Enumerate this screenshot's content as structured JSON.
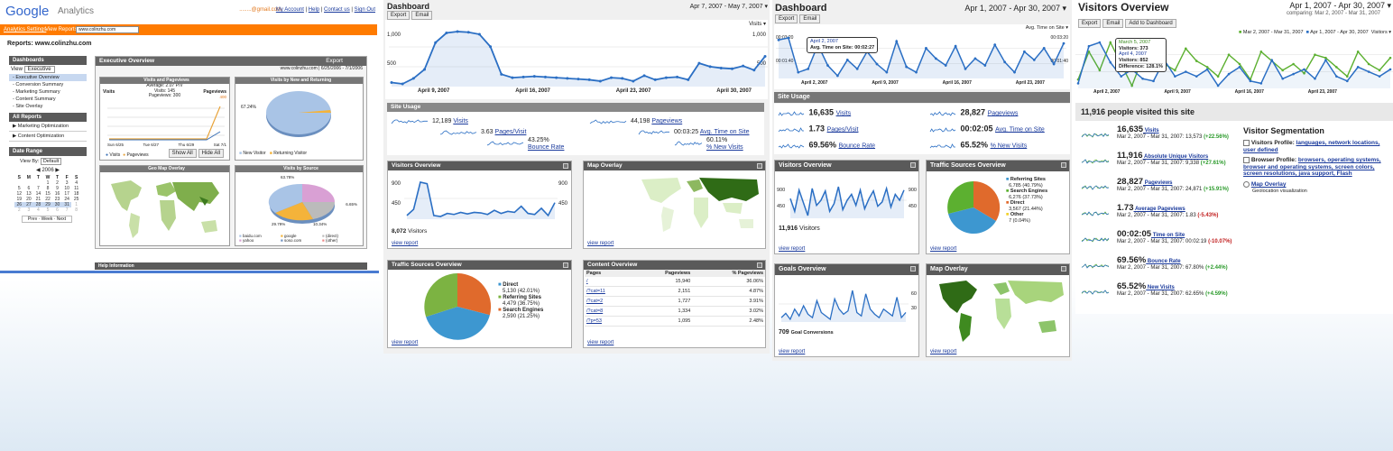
{
  "ga1": {
    "logo_google": "Google",
    "logo_analytics": "Analytics",
    "email": "........@gmail.com",
    "top_links": [
      "My Account",
      "Help",
      "Contact us",
      "Sign Out"
    ],
    "nav": [
      "Analytics Settings",
      "View Reports:"
    ],
    "site_select": "www.colinzhu.com",
    "reports_title": "Reports: www.colinzhu.com",
    "dash_hdr": "Dashboards",
    "view_label": "View",
    "view_select": "Executive",
    "menu": [
      "- Executive Overview",
      "- Conversion Summary",
      "- Marketing Summary",
      "- Content Summary",
      "- Site Overlay"
    ],
    "all_reports": "All Reports",
    "all_items": [
      "Marketing Optimization",
      "Content Optimization"
    ],
    "date_range": "Date Range",
    "viewby": "View By:",
    "viewby_val": "Default",
    "cal_month": "2006",
    "cal_days": [
      "S",
      "M",
      "T",
      "W",
      "T",
      "F",
      "S"
    ],
    "cal_nav": "Prev · Week · Next",
    "exec_title": "Executive Overview",
    "export": "Export",
    "site_date": "www.colinzhu.com",
    "date_span": "6/25/2006 - 7/1/2006",
    "vp_title": "Visits and Pageviews",
    "vp_avg": "Average: 2.07 P/V",
    "vp_visits": "Visits: 145",
    "vp_pv": "Pageviews: 300",
    "vp_l": "Visits",
    "vp_r": "Pageviews",
    "vp_rval": "400",
    "vp_days": [
      "Sun 6/25",
      "Tue 6/27",
      "Thu 6/29",
      "Sat 7/1"
    ],
    "legend_v": "Visits",
    "legend_p": "Pageviews",
    "show_all": "Show All",
    "hide_all": "Hide All",
    "nr_title": "Visits by New and Returning",
    "nr_pct": "67.24%",
    "nr_leg": [
      "New Visitor",
      "Returning Visitor"
    ],
    "geo_title": "Geo Map Overlay",
    "src_title": "Visits by Source",
    "src_pcts": [
      "63.78%",
      "6.65%",
      "29.79%",
      "10.34%"
    ],
    "src_leg": [
      "baidu.com",
      "google",
      "(direct)",
      "yahoo",
      "soso.com",
      "(other)"
    ],
    "help": "Help Information"
  },
  "ga2": {
    "title": "Dashboard",
    "date": "Apr 7, 2007 - May 7, 2007",
    "export": "Export",
    "email": "Email",
    "metric": "Visits",
    "y_top": "1,000",
    "y_mid": "500",
    "y_top_r": "1,000",
    "y_mid_r": "500",
    "x_labels": [
      "April 9, 2007",
      "April 16, 2007",
      "April 23, 2007",
      "April 30, 2007"
    ],
    "site_usage": "Site Usage",
    "usage": [
      {
        "v": "12,189",
        "l": "Visits"
      },
      {
        "v": "3.63",
        "l": "Pages/Visit"
      },
      {
        "v": "43.25%",
        "l": "Bounce Rate"
      },
      {
        "v": "44,198",
        "l": "Pageviews"
      },
      {
        "v": "00:03:25",
        "l": "Avg. Time on Site"
      },
      {
        "v": "60.11%",
        "l": "% New Visits"
      }
    ],
    "vo_title": "Visitors Overview",
    "vo_y": [
      "900",
      "450"
    ],
    "vo_visitors": "8,072",
    "vo_vl": "Visitors",
    "map_title": "Map Overlay",
    "ts_title": "Traffic Sources Overview",
    "ts": [
      {
        "n": "Direct",
        "v": "5,130 (42.01%)"
      },
      {
        "n": "Referring Sites",
        "v": "4,479 (36.75%)"
      },
      {
        "n": "Search Engines",
        "v": "2,590 (21.25%)"
      }
    ],
    "co_title": "Content Overview",
    "co_head": [
      "Pages",
      "Pageviews",
      "% Pageviews"
    ],
    "co_rows": [
      [
        "/",
        "15,940",
        "36.06%"
      ],
      [
        "/?cat=11",
        "2,151",
        "4.87%"
      ],
      [
        "/?cat=2",
        "1,727",
        "3.91%"
      ],
      [
        "/?cat=8",
        "1,334",
        "3.02%"
      ],
      [
        "/?p=53",
        "1,095",
        "2.48%"
      ]
    ],
    "view_report": "view report"
  },
  "ga3": {
    "title": "Dashboard",
    "date": "Apr 1, 2007 - Apr 30, 2007",
    "export": "Export",
    "email": "Email",
    "metric": "Avg. Time on Site",
    "yl": [
      "00:03:20",
      "00:01:40"
    ],
    "yr": [
      "00:03:20",
      "00:01:40"
    ],
    "tt_date": "April 2, 2007",
    "tt_text": "Avg. Time on Site: 00:02:27",
    "x_labels": [
      "April 2, 2007",
      "April 9, 2007",
      "April 16, 2007",
      "April 23, 2007"
    ],
    "site_usage": "Site Usage",
    "usage": [
      {
        "v": "16,635",
        "l": "Visits"
      },
      {
        "v": "28,827",
        "l": "Pageviews"
      },
      {
        "v": "1.73",
        "l": "Pages/Visit"
      },
      {
        "v": "00:02:05",
        "l": "Avg. Time on Site"
      },
      {
        "v": "69.56%",
        "l": "Bounce Rate"
      },
      {
        "v": "65.52%",
        "l": "% New Visits"
      }
    ],
    "vo_title": "Visitors Overview",
    "vo_y": [
      "900",
      "450"
    ],
    "vo_visitors": "11,916",
    "vo_vl": "Visitors",
    "ts_title": "Traffic Sources Overview",
    "ts": [
      {
        "n": "Referring Sites",
        "v": "6,785 (40.79%)"
      },
      {
        "n": "Search Engines",
        "v": "6,276 (37.73%)"
      },
      {
        "n": "Direct",
        "v": "3,567 (21.44%)"
      },
      {
        "n": "Other",
        "v": "7 (0.04%)"
      }
    ],
    "go_title": "Goals Overview",
    "go_y": [
      "60",
      "30"
    ],
    "go_val": "709",
    "go_l": "Goal Conversions",
    "map_title": "Map Overlay",
    "view_report": "view report"
  },
  "ga4": {
    "title": "Visitors Overview",
    "date": "Apr 1, 2007 - Apr 30, 2007",
    "comparing": "comparing: Mar 2, 2007 - Mar 31, 2007",
    "export": "Export",
    "email": "Email",
    "add": "Add to Dashboard",
    "leg1": "Mar 2, 2007 - Mar 31, 2007",
    "leg2": "Apr 1, 2007 - Apr 30, 2007",
    "metric": "Visitors",
    "tt_d1": "March 5, 2007",
    "tt_v1": "Visitors: 373",
    "tt_d2": "April 4, 2007",
    "tt_v2": "Visitors: 852",
    "tt_diff": "Difference: 128.1%",
    "x_labels": [
      "April 2, 2007",
      "April 9, 2007",
      "April 16, 2007",
      "April 23, 2007"
    ],
    "people": "11,916 people visited this site",
    "metrics": [
      {
        "v": "16,635",
        "l": "Visits",
        "s": "Mar 2, 2007 - Mar 31, 2007: 13,573",
        "d": "(+22.56%)",
        "c": "#2a9a2a"
      },
      {
        "v": "11,916",
        "l": "Absolute Unique Visitors",
        "s": "Mar 2, 2007 - Mar 31, 2007: 9,338",
        "d": "(+27.61%)",
        "c": "#2a9a2a"
      },
      {
        "v": "28,827",
        "l": "Pageviews",
        "s": "Mar 2, 2007 - Mar 31, 2007: 24,871",
        "d": "(+15.91%)",
        "c": "#2a9a2a"
      },
      {
        "v": "1.73",
        "l": "Average Pageviews",
        "s": "Mar 2, 2007 - Mar 31, 2007: 1.83",
        "d": "(-5.43%)",
        "c": "#c01c1c"
      },
      {
        "v": "00:02:05",
        "l": "Time on Site",
        "s": "Mar 2, 2007 - Mar 31, 2007: 00:02:19",
        "d": "(-10.07%)",
        "c": "#c01c1c"
      },
      {
        "v": "69.56%",
        "l": "Bounce Rate",
        "s": "Mar 2, 2007 - Mar 31, 2007: 67.80%",
        "d": "(+2.44%)",
        "c": "#2a9a2a"
      },
      {
        "v": "65.52%",
        "l": "New Visits",
        "s": "Mar 2, 2007 - Mar 31, 2007: 62.65%",
        "d": "(+4.59%)",
        "c": "#2a9a2a"
      }
    ],
    "seg_title": "Visitor Segmentation",
    "seg1_l": "Visitors Profile:",
    "seg1": "languages, network locations, user defined",
    "seg2_l": "Browser Profile:",
    "seg2": "browsers, operating systems, browser and operating systems, screen colors, screen resolutions, java support, Flash",
    "seg3": "Map Overlay",
    "seg3_s": "Geolocation visualization"
  }
}
